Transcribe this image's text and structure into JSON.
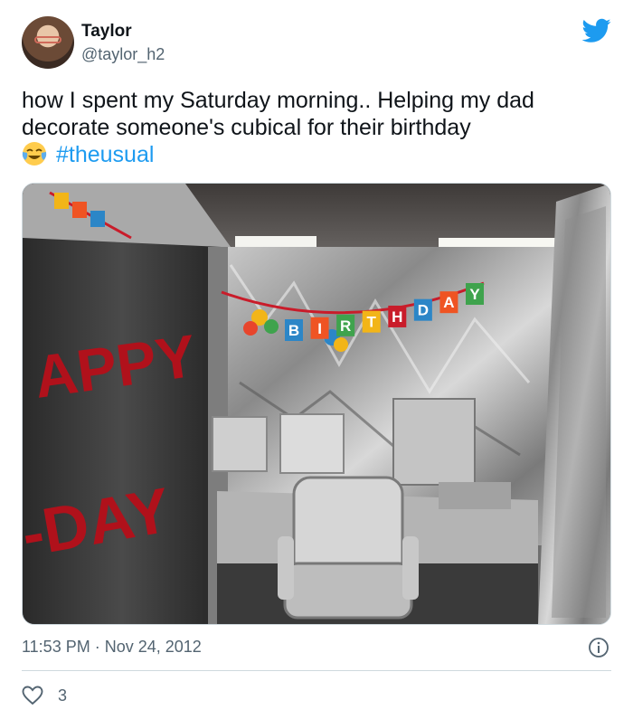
{
  "author": {
    "display_name": "Taylor",
    "handle": "@taylor_h2"
  },
  "tweet": {
    "text_line": "how I spent my Saturday morning.. Helping my dad decorate someone's cubical for their birthday",
    "emoji": "face-with-tears-of-joy",
    "hashtag": "#theusual"
  },
  "photo": {
    "banner_letters": [
      "B",
      "I",
      "R",
      "T",
      "H",
      "D",
      "A",
      "Y"
    ],
    "sign_left_1": "APPY",
    "sign_left_2": "-DAY"
  },
  "meta": {
    "timestamp": "11:53 PM · Nov 24, 2012"
  },
  "actions": {
    "like_count": "3"
  },
  "colors": {
    "brand_blue": "#1d9bf0",
    "text_primary": "#0f1419",
    "text_secondary": "#536471",
    "divider": "#cfd9de"
  },
  "icons": {
    "brand": "twitter-bird-icon",
    "info": "info-icon",
    "like": "heart-icon"
  }
}
